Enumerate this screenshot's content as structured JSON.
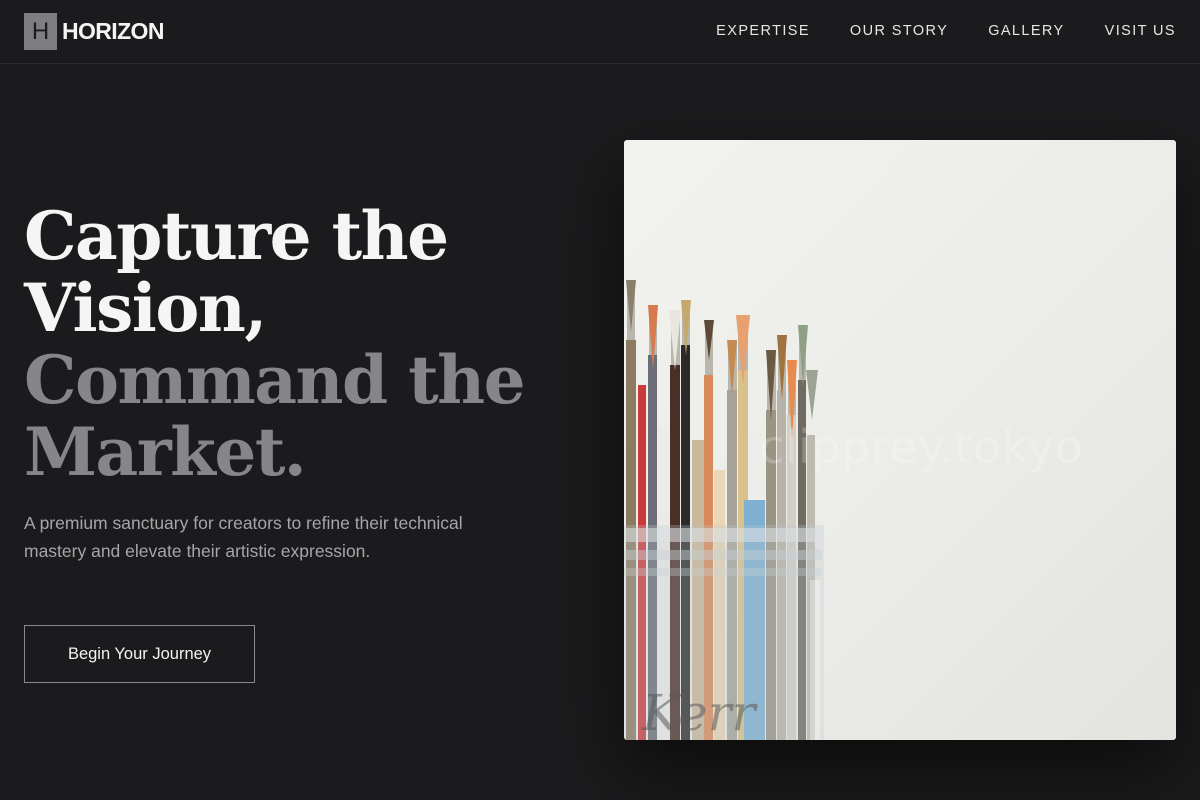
{
  "brand": {
    "logo_letter": "H",
    "name": "HORIZON"
  },
  "nav": {
    "items": [
      {
        "label": "EXPERTISE"
      },
      {
        "label": "OUR STORY"
      },
      {
        "label": "GALLERY"
      },
      {
        "label": "VISIT US"
      }
    ]
  },
  "hero": {
    "headline_lines": [
      "Capture the",
      "Vision,",
      "Command the",
      "Market."
    ],
    "subtitle": "A premium sanctuary for creators to refine their technical mastery and elevate their artistic expression.",
    "cta_label": "Begin Your Journey",
    "image": {
      "subject": "brushes-in-glass-jar",
      "watermark": "clipprey.tokyo",
      "jar_text": "Kerr"
    }
  },
  "colors": {
    "background": "#1b1b1d",
    "text_primary": "#f5f5f5",
    "text_dim": "#868688",
    "text_muted": "#a6a6a8",
    "border": "#8a8a8c"
  }
}
